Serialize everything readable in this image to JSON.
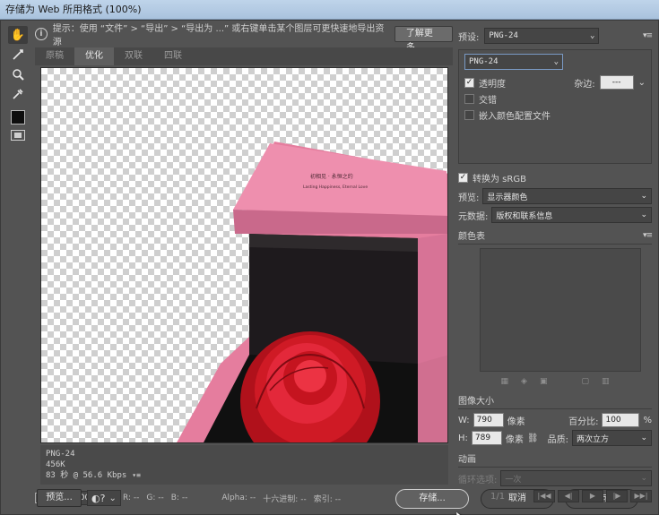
{
  "window": {
    "title": "存储为 Web 所用格式 (100%)"
  },
  "tools": {
    "hand": "hand-icon",
    "slice_select": "slice-select-icon",
    "zoom": "zoom-icon",
    "eyedropper": "eyedropper-icon"
  },
  "hint": {
    "text": "提示：使用 “文件” > “导出” > “导出为 ...” 或右键单击某个图层可更快速地导出资源",
    "button": "了解更多"
  },
  "preview_tabs": [
    "原稿",
    "优化",
    "双联",
    "四联"
  ],
  "active_tab": 1,
  "image_info": {
    "format": "PNG-24",
    "size": "456K",
    "time": "83 秒 @ 56.6 Kbps"
  },
  "box_text": {
    "brand": "初相见 · 永恒之约",
    "sub": "Lasting Happiness, Eternal Love"
  },
  "status": {
    "zoom": "100%",
    "r": "R: --",
    "g": "G: --",
    "b": "B: --",
    "alpha": "Alpha: --",
    "hex": "十六进制: --",
    "index": "索引: --"
  },
  "bottom": {
    "preview": "预览...",
    "save": "存储...",
    "cancel": "取消",
    "done": "完成"
  },
  "settings": {
    "preset_label": "预设:",
    "preset": "PNG-24",
    "format": "PNG-24",
    "transparency_label": "透明度",
    "transparency": true,
    "matte_label": "杂边:",
    "matte_value": "---",
    "interlaced_label": "交错",
    "interlaced": false,
    "embed_label": "嵌入颜色配置文件",
    "embed": false,
    "convert_label": "转换为 sRGB",
    "convert": true,
    "preview_label": "预览:",
    "preview_value": "显示器颜色",
    "metadata_label": "元数据:",
    "metadata_value": "版权和联系信息"
  },
  "color_table": {
    "title": "颜色表"
  },
  "image_size": {
    "title": "图像大小",
    "w_label": "W:",
    "w": "790",
    "h_label": "H:",
    "h": "789",
    "unit": "像素",
    "percent_label": "百分比:",
    "percent": "100",
    "percent_unit": "%",
    "quality_label": "品质:",
    "quality": "两次立方"
  },
  "animation": {
    "title": "动画",
    "loop_label": "循环选项:",
    "loop_value": "一次",
    "frame": "1/1"
  }
}
